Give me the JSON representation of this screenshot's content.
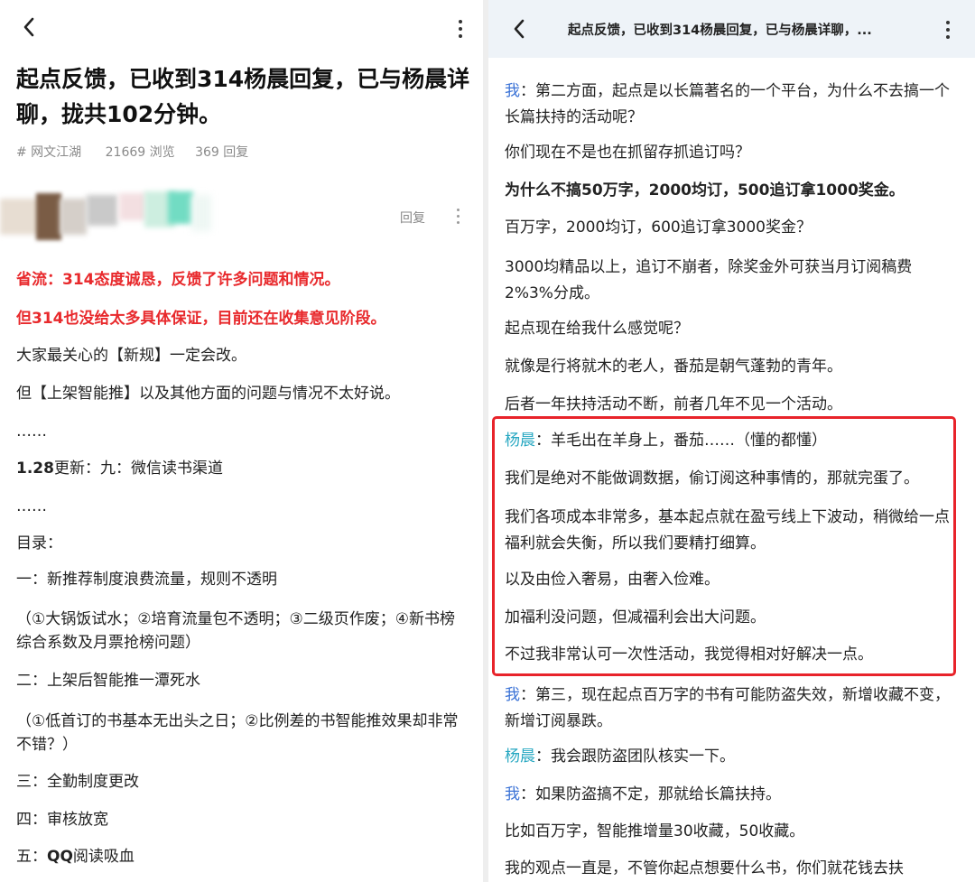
{
  "left": {
    "back_icon": "chevron-left-icon",
    "more_icon": "vertical-dots-icon",
    "title": "起点反馈，已收到314杨晨回复，已与杨晨详聊，拢共102分钟。",
    "meta": {
      "tag": "# 网文江湖",
      "views": "21669 浏览",
      "replies": "369 回复"
    },
    "reply_label": "回复",
    "body": {
      "l1a": "省流：",
      "l1b": "314态度诚恳，反馈了许多问题和情况。",
      "l2": "但314也没给太多具体保证，目前还在收集意见阶段。",
      "l3": "大家最关心的【新规】一定会改。",
      "l4": "但【上架智能推】以及其他方面的问题与情况不太好说。",
      "l5": "……",
      "l6a": "1.28",
      "l6b": "更新：九：微信读书渠道",
      "l7": "……",
      "l8": "目录：",
      "l9": "一：新推荐制度浪费流量，规则不透明",
      "l10": "（①大锅饭试水；②培育流量包不透明；③二级页作废；④新书榜综合系数及月票抢榜问题）",
      "l11": "二：上架后智能推一潭死水",
      "l12": "（①低首订的书基本无出头之日；②比例差的书智能推效果却非常不错？）",
      "l13": "三：全勤制度更改",
      "l14": "四：审核放宽",
      "l15a": "五：",
      "l15b": "QQ",
      "l15c": "阅读吸血"
    }
  },
  "right": {
    "header_title": "起点反馈，已收到314杨晨回复，已与杨晨详聊，...",
    "speaker_me": "我",
    "speaker_yc": "杨晨",
    "colon": "：",
    "r1": "第二方面，起点是以长篇著名的一个平台，为什么不去搞一个长篇扶持的活动呢？",
    "r2": "你们现在不是也在抓留存抓追订吗？",
    "r3": "为什么不搞50万字，2000均订，500追订拿1000奖金。",
    "r4": "百万字，2000均订，600追订拿3000奖金？",
    "r5": "3000均精品以上，追订不崩者，除奖金外可获当月订阅稿费2%3%分成。",
    "r6": "起点现在给我什么感觉呢？",
    "r7": "就像是行将就木的老人，番茄是朝气蓬勃的青年。",
    "r8": "后者一年扶持活动不断，前者几年不见一个活动。",
    "r9": "羊毛出在羊身上，番茄……（懂的都懂）",
    "r10": "我们是绝对不能做调数据，偷订阅这种事情的，那就完蛋了。",
    "r11": "我们各项成本非常多，基本起点就在盈亏线上下波动，稍微给一点福利就会失衡，所以我们要精打细算。",
    "r12": "以及由俭入奢易，由奢入俭难。",
    "r13": "加福利没问题，但减福利会出大问题。",
    "r14": "不过我非常认可一次性活动，我觉得相对好解决一点。",
    "r15": "第三，现在起点百万字的书有可能防盗失效，新增收藏不变，新增订阅暴跌。",
    "r16": "我会跟防盗团队核实一下。",
    "r17": "如果防盗搞不定，那就给长篇扶持。",
    "r18": "比如百万字，智能推增量30收藏，50收藏。",
    "r19": "我的观点一直是，不管你起点想要什么书，你们就花钱去扶"
  }
}
